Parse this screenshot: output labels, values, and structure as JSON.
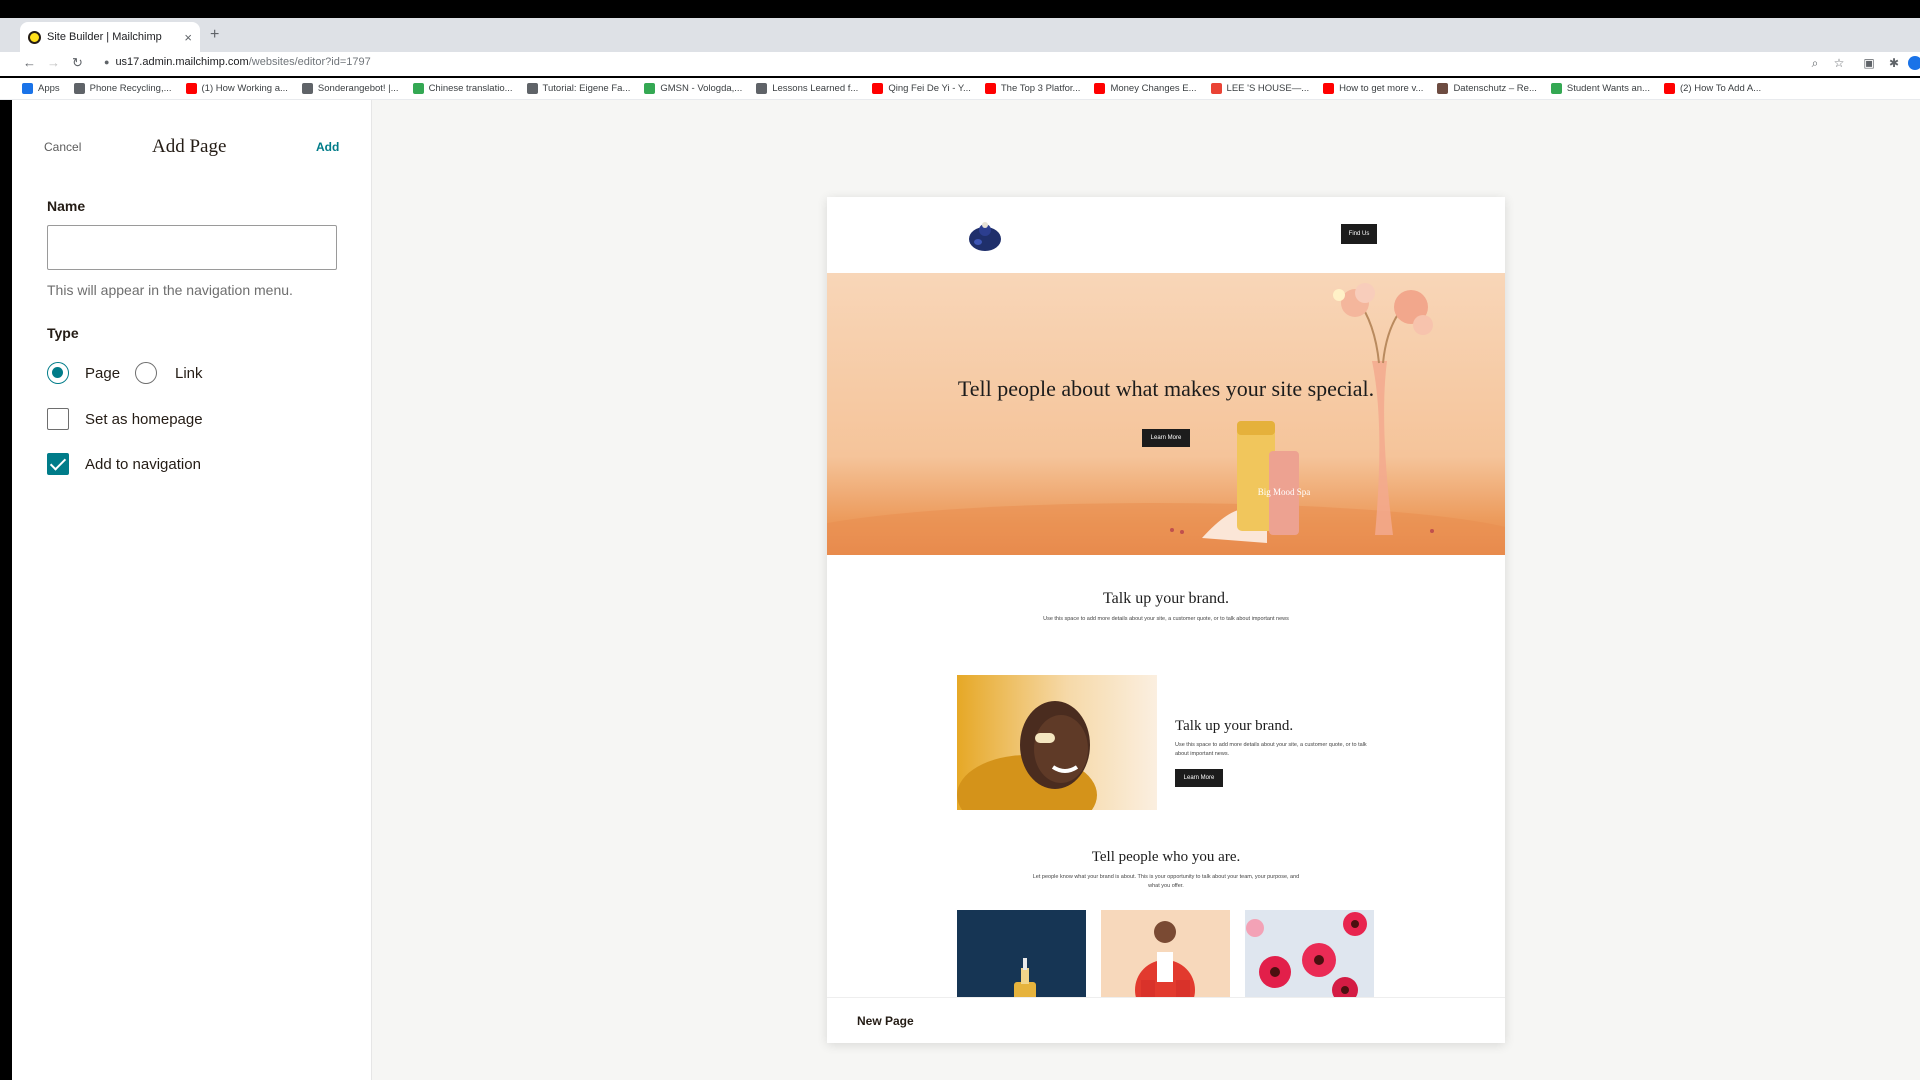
{
  "browser": {
    "tab_title": "Site Builder | Mailchimp",
    "tab_close": "×",
    "new_tab": "+",
    "url_host": "us17.admin.mailchimp.com",
    "url_path": "/websites/editor?id=1797",
    "bookmarks": [
      {
        "label": "Apps",
        "color": "#1a73e8"
      },
      {
        "label": "Phone Recycling,...",
        "color": "#5f6368"
      },
      {
        "label": "(1) How Working a...",
        "color": "#ff0000"
      },
      {
        "label": "Sonderangebot! |...",
        "color": "#5f6368"
      },
      {
        "label": "Chinese translatio...",
        "color": "#34a853"
      },
      {
        "label": "Tutorial: Eigene Fa...",
        "color": "#5f6368"
      },
      {
        "label": "GMSN - Vologda,...",
        "color": "#34a853"
      },
      {
        "label": "Lessons Learned f...",
        "color": "#5f6368"
      },
      {
        "label": "Qing Fei De Yi - Y...",
        "color": "#ff0000"
      },
      {
        "label": "The Top 3 Platfor...",
        "color": "#ff0000"
      },
      {
        "label": "Money Changes E...",
        "color": "#ff0000"
      },
      {
        "label": "LEE 'S HOUSE—...",
        "color": "#ea4335"
      },
      {
        "label": "How to get more v...",
        "color": "#ff0000"
      },
      {
        "label": "Datenschutz – Re...",
        "color": "#6d4c41"
      },
      {
        "label": "Student Wants an...",
        "color": "#34a853"
      },
      {
        "label": "(2) How To Add A...",
        "color": "#ff0000"
      }
    ]
  },
  "panel": {
    "cancel": "Cancel",
    "title": "Add Page",
    "add": "Add",
    "name_label": "Name",
    "name_value": "",
    "name_hint": "This will appear in the navigation menu.",
    "type_label": "Type",
    "type_options": [
      "Page",
      "Link"
    ],
    "type_selected": "Page",
    "homepage_label": "Set as homepage",
    "homepage_checked": false,
    "nav_label": "Add to navigation",
    "nav_checked": true
  },
  "preview": {
    "find_us": "Find Us",
    "hero_title": "Tell people about what makes your site special.",
    "hero_button": "Learn More",
    "section1_title": "Talk up your brand.",
    "section1_text": "Use this space to add more details about your site, a customer quote, or to talk about important news",
    "section2_title": "Talk up your brand.",
    "section2_text": "Use this space to add more details about your site, a customer quote, or to talk about important news.",
    "section2_button": "Learn More",
    "section3_title": "Tell people who you are.",
    "section3_text": "Let people know what your brand is about. This is your opportunity to talk about your team, your purpose, and what you offer.",
    "footer_page": "New Page",
    "jar_text": "Big Mood Spa"
  }
}
